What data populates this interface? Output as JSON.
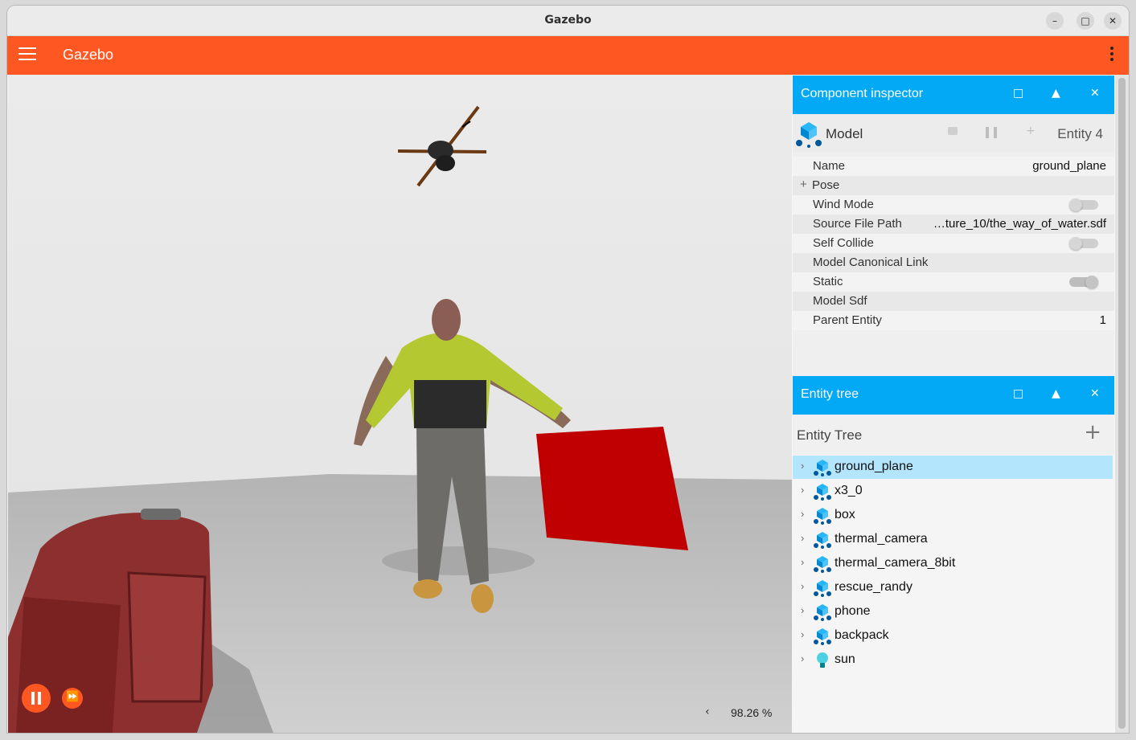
{
  "window": {
    "title": "Gazebo"
  },
  "app": {
    "title": "Gazebo"
  },
  "viewport": {
    "rtf": "98.26 %"
  },
  "inspector": {
    "title": "Component inspector",
    "type": "Model",
    "entity": "Entity 4",
    "rows": {
      "name_label": "Name",
      "name_value": "ground_plane",
      "pose_label": "Pose",
      "wind_label": "Wind Mode",
      "wind_on": false,
      "source_label": "Source File Path",
      "source_value": "…ture_10/the_way_of_water.sdf",
      "collide_label": "Self Collide",
      "collide_on": false,
      "canon_label": "Model Canonical Link",
      "static_label": "Static",
      "static_on": true,
      "sdf_label": "Model Sdf",
      "parent_label": "Parent Entity",
      "parent_value": "1"
    }
  },
  "tree": {
    "title": "Entity tree",
    "header": "Entity Tree",
    "items": [
      {
        "label": "ground_plane",
        "icon": "model-icon",
        "selected": true
      },
      {
        "label": "x3_0",
        "icon": "model-icon"
      },
      {
        "label": "box",
        "icon": "model-icon"
      },
      {
        "label": "thermal_camera",
        "icon": "model-icon"
      },
      {
        "label": "thermal_camera_8bit",
        "icon": "model-icon"
      },
      {
        "label": "rescue_randy",
        "icon": "model-icon"
      },
      {
        "label": "phone",
        "icon": "model-icon"
      },
      {
        "label": "backpack",
        "icon": "model-icon"
      },
      {
        "label": "sun",
        "icon": "light-bulb-icon"
      }
    ]
  },
  "colors": {
    "accent": "#ff5722",
    "panel_header": "#03a9f4",
    "selection": "#b3e5fc"
  }
}
